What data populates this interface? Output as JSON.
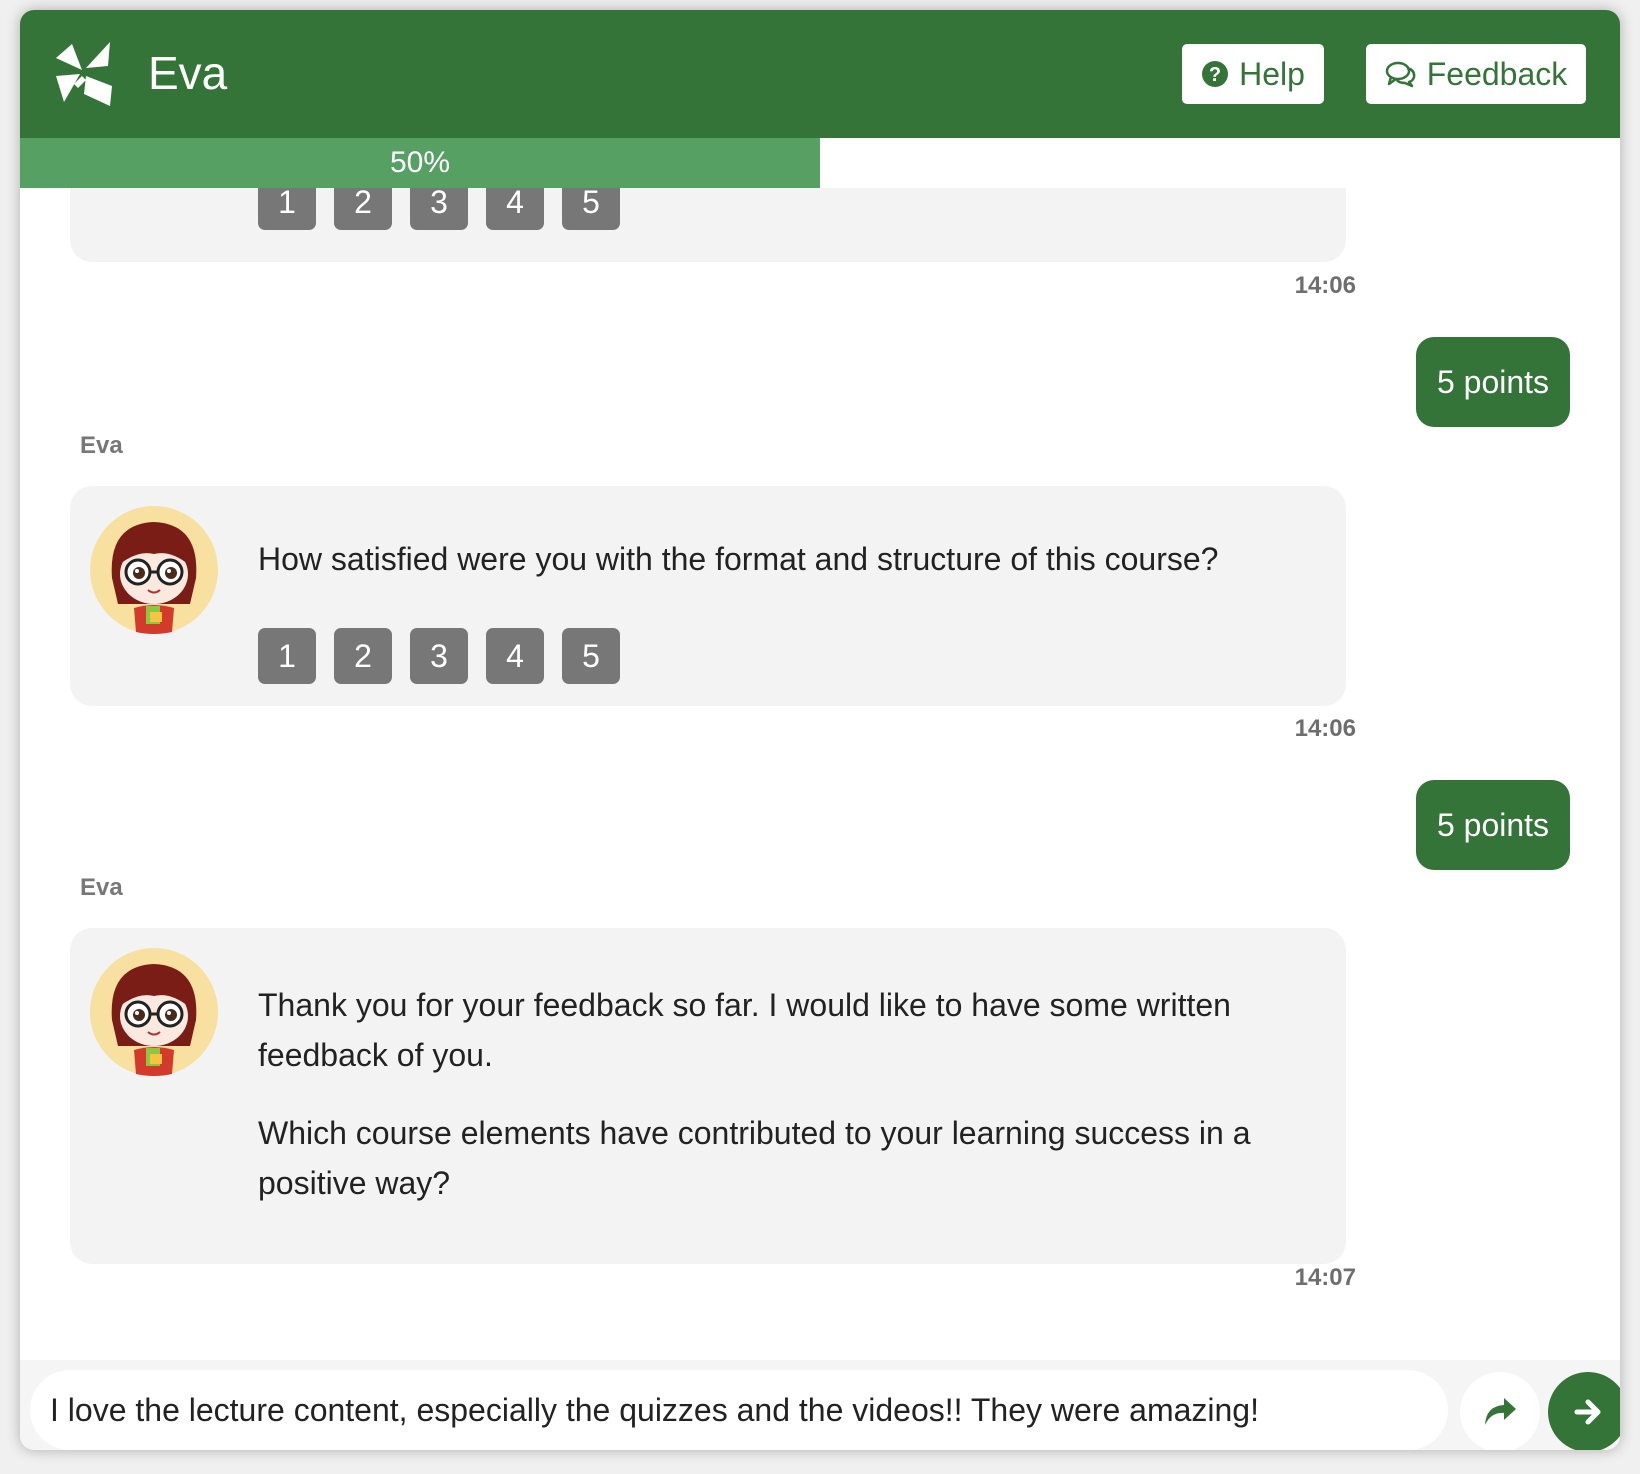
{
  "app": {
    "title": "Eva"
  },
  "header": {
    "help_label": "Help",
    "feedback_label": "Feedback"
  },
  "progress": {
    "value": 0.5,
    "label": "50%"
  },
  "colors": {
    "brand": "#347438",
    "progress": "#56a064",
    "rating_button": "#777777",
    "bubble_bg": "#f3f3f3"
  },
  "icons": {
    "logo": "eva-logo-icon",
    "help": "question-circle-icon",
    "feedback": "chat-bubbles-icon",
    "skip": "share-arrow-icon",
    "send": "arrow-right-icon"
  },
  "messages": {
    "m1": {
      "rating": [
        "1",
        "2",
        "3",
        "4",
        "5"
      ],
      "time": "14:06"
    },
    "r1": {
      "text": "5 points"
    },
    "m2": {
      "sender": "Eva",
      "text": "How satisfied were you with the format and structure of this course?",
      "rating": [
        "1",
        "2",
        "3",
        "4",
        "5"
      ],
      "time": "14:06"
    },
    "r2": {
      "text": "5 points"
    },
    "m3": {
      "sender": "Eva",
      "p1": "Thank you for your feedback so far. I would like to have some written feedback of you.",
      "p2": "Which course elements have contributed to your learning success in a positive way?",
      "time": "14:07"
    }
  },
  "input": {
    "value": "I love the lecture content, especially the quizzes and the videos!! They were amazing!"
  }
}
